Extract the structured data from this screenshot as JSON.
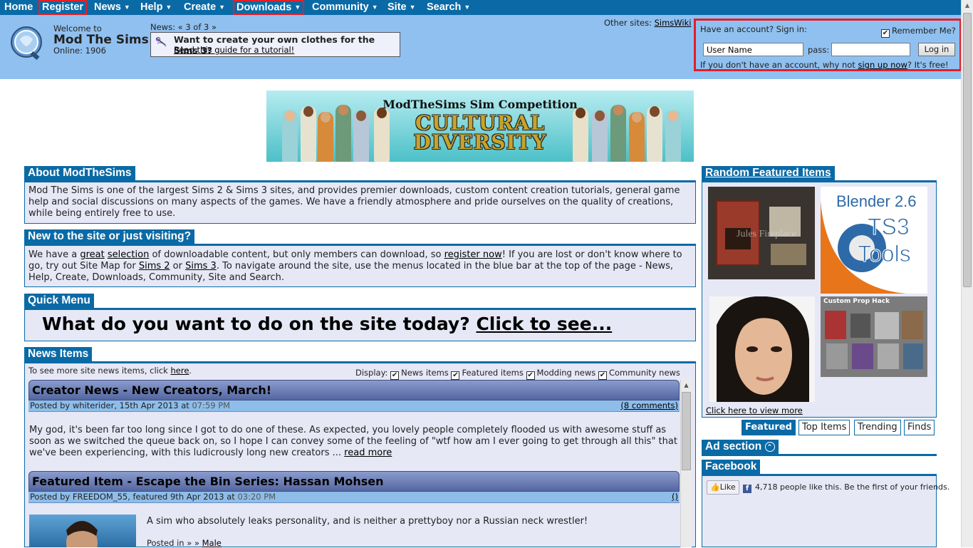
{
  "nav": [
    {
      "label": "Home",
      "has_menu": false,
      "boxed": false
    },
    {
      "label": "Register",
      "has_menu": false,
      "boxed": true
    },
    {
      "label": "News",
      "has_menu": true,
      "boxed": false
    },
    {
      "label": "Help",
      "has_menu": true,
      "boxed": false
    },
    {
      "label": "Create",
      "has_menu": true,
      "boxed": false
    },
    {
      "label": "Downloads",
      "has_menu": true,
      "boxed": true
    },
    {
      "label": "Community",
      "has_menu": true,
      "boxed": false
    },
    {
      "label": "Site",
      "has_menu": true,
      "boxed": false
    },
    {
      "label": "Search",
      "has_menu": true,
      "boxed": false
    }
  ],
  "header": {
    "welcome_to": "Welcome to",
    "site_name": "Mod The Sims",
    "online": "Online: 1906",
    "news_label": "News:",
    "news_prev": "«",
    "news_count": "3 of 3",
    "news_next": "»",
    "news_title": "Want to create your own clothes for the Sims 3?",
    "news_link": "Read this guide for a tutorial!",
    "other_sites_label": "Other sites:",
    "other_sites_link": "SimsWiki"
  },
  "login": {
    "title": "Have an account? Sign in:",
    "remember_label": "Remember Me?",
    "remember_checked": true,
    "username_value": "User Name",
    "pass_label": "pass:",
    "login_button": "Log in",
    "signup_prefix": "If you don't have an account, why not",
    "signup_link": "sign up now",
    "signup_suffix": "? It's free!"
  },
  "banner": {
    "line1": "ModTheSims Sim Competition",
    "line2a": "CULTURAL",
    "line2b": "DIVERSITY"
  },
  "about": {
    "title": "About ModTheSims",
    "text": "Mod The Sims is one of the largest Sims 2 & Sims 3 sites, and provides premier downloads, custom content creation tutorials, general game help and social discussions on many aspects of the games. We have a friendly atmosphere and pride ourselves on the quality of creations, while being entirely free to use."
  },
  "newsite": {
    "title": "New to the site or just visiting?",
    "t1": "We have a ",
    "l1": "great",
    "l2": "selection",
    "t2": " of downloadable content, but only members can download, so ",
    "l3": "register now",
    "t3": "! If you are lost or don't know where to go, try out Site Map for ",
    "l4": "Sims 2",
    "t4": " or ",
    "l5": "Sims 3",
    "t5": ". To navigate around the site, use the menus located in the blue bar at the top of the page - News, Help, Create, Downloads, Community, Site and Search."
  },
  "quickmenu": {
    "title": "Quick Menu",
    "question": "What do you want to do on the site today?",
    "link": "Click to see..."
  },
  "news": {
    "title": "News Items",
    "more_prefix": "To see more site news items, click",
    "more_link": "here",
    "display_label": "Display:",
    "filters": [
      {
        "label": "News items",
        "checked": true
      },
      {
        "label": "Featured items",
        "checked": true
      },
      {
        "label": "Modding news",
        "checked": true
      },
      {
        "label": "Community news",
        "checked": true
      }
    ],
    "items": [
      {
        "title": "Creator News - New Creators, March!",
        "byline": "Posted by whiterider, 15th Apr 2013 at",
        "time": "07:59 PM",
        "comments": "(8 comments)",
        "body": "My god, it's been far too long since I got to do one of these. As expected, you lovely people completely flooded us with awesome stuff as soon as we switched the queue back on, so I hope I can convey some of the feeling of \"wtf how am I ever going to get through all this\" that we've been experiencing, with this ludicrously long new creators ...",
        "read_more": "read more"
      },
      {
        "title": "Featured Item - Escape the Bin Series: Hassan Mohsen",
        "byline": "Posted by FREEDOM_55, featured 9th Apr 2013 at",
        "time": "03:20 PM",
        "comments": "()",
        "body": "A sim who absolutely leaks personality, and is neither a prettyboy nor a Russian neck wrestler!",
        "posted_in": "Posted in » »",
        "posted_link": "Male"
      }
    ]
  },
  "random": {
    "title": "Random Featured Items",
    "thumb2_line1": "Blender 2.6",
    "thumb2_line2": "TS3",
    "thumb2_line3": "Tools",
    "thumb4_caption": "Custom Prop Hack",
    "view_more": "Click here to view more",
    "tabs": [
      "Featured",
      "Top Items",
      "Trending",
      "Finds"
    ],
    "active_tab": "Featured"
  },
  "ad": {
    "title": "Ad section"
  },
  "facebook": {
    "title": "Facebook",
    "like": "Like",
    "text": "4,718 people like this. Be the first of your friends."
  }
}
